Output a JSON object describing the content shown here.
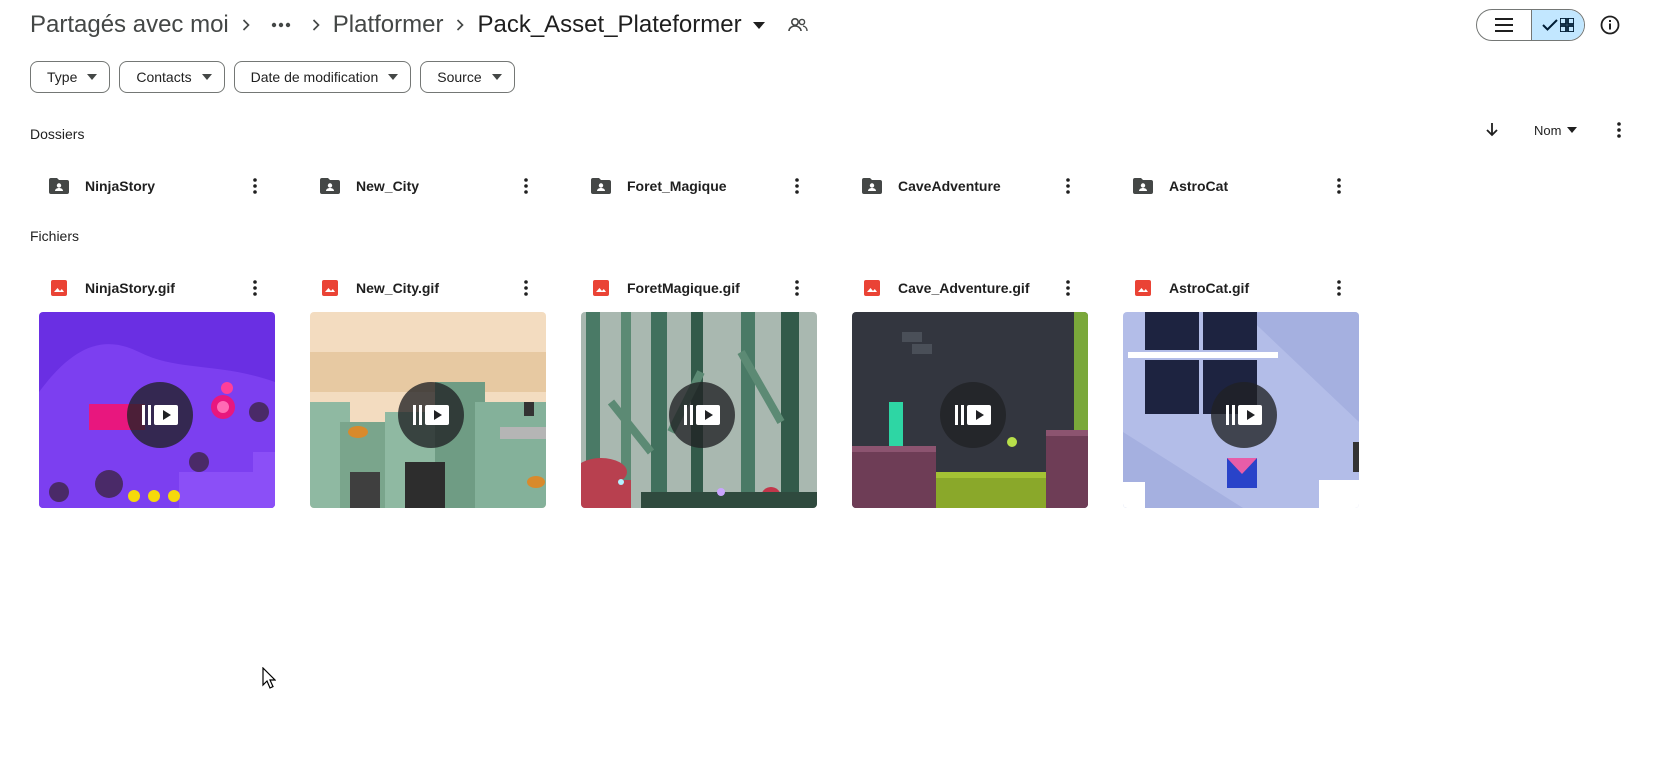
{
  "breadcrumb": {
    "root": "Partagés avec moi",
    "middle": "Platformer",
    "current": "Pack_Asset_Plateformer"
  },
  "filters": [
    {
      "label": "Type"
    },
    {
      "label": "Contacts"
    },
    {
      "label": "Date de modification"
    },
    {
      "label": "Source"
    }
  ],
  "sections": {
    "folders_title": "Dossiers",
    "files_title": "Fichiers"
  },
  "sort": {
    "label": "Nom"
  },
  "folders": [
    {
      "name": "NinjaStory"
    },
    {
      "name": "New_City"
    },
    {
      "name": "Foret_Magique"
    },
    {
      "name": "CaveAdventure"
    },
    {
      "name": "AstroCat"
    }
  ],
  "files": [
    {
      "name": "NinjaStory.gif",
      "theme": "purple"
    },
    {
      "name": "New_City.gif",
      "theme": "city"
    },
    {
      "name": "ForetMagique.gif",
      "theme": "forest"
    },
    {
      "name": "Cave_Adventure.gif",
      "theme": "cave"
    },
    {
      "name": "AstroCat.gif",
      "theme": "space"
    }
  ],
  "colors": {
    "accent": "#c2e7ff",
    "image_icon": "#ea4335",
    "folder_icon": "#444746"
  }
}
